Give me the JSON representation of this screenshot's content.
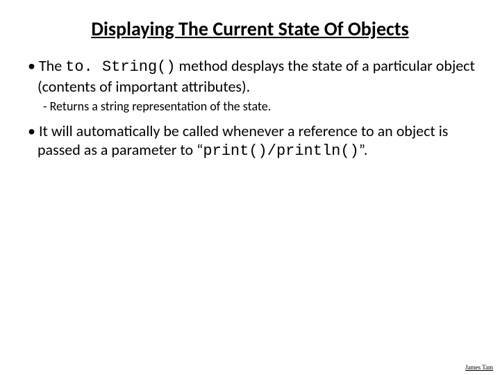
{
  "title": "Displaying The Current State Of Objects",
  "bullet1": {
    "pre": "The ",
    "code": "to. String()",
    "post": " method desplays the state of a particular object (contents of important attributes)."
  },
  "sub1": "Returns a string representation of the state.",
  "bullet2": {
    "pre": "It will automatically be called whenever a reference to an object is passed as a parameter to “",
    "code": "print()/println()",
    "post": "”."
  },
  "footer": "James Tam"
}
